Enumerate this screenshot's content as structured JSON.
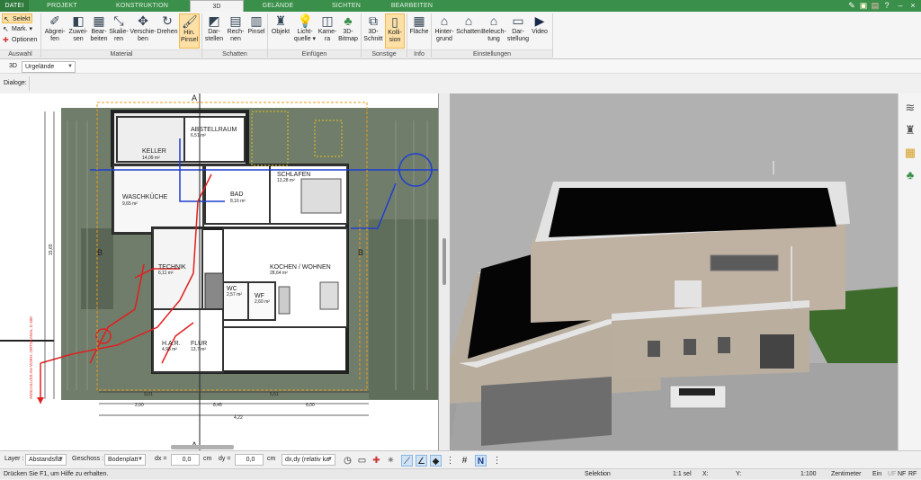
{
  "tabs": [
    {
      "label": "DATEI",
      "kind": "file"
    },
    {
      "label": "PROJEKT",
      "kind": "normal"
    },
    {
      "label": "KONSTRUKTION",
      "kind": "normal"
    },
    {
      "label": "3D",
      "kind": "active"
    },
    {
      "label": "GELÄNDE",
      "kind": "normal"
    },
    {
      "label": "SICHTEN",
      "kind": "normal"
    },
    {
      "label": "BEARBEITEN",
      "kind": "normal"
    }
  ],
  "ribbon": {
    "auswahl": {
      "select": "Selekt",
      "mark": "Mark.",
      "options": "Optionen",
      "group": "Auswahl"
    },
    "material": {
      "group": "Material",
      "buttons": [
        "Abgrei-\nfen",
        "Zuwei-\nsen",
        "Bear-\nbeiten",
        "Skalie-\nren",
        "Verschie-\nben",
        "Drehen",
        "Hin.\nPinsel"
      ]
    },
    "schatten": {
      "group": "Schatten",
      "buttons": [
        "Dar-\nstellen",
        "Rech-\nnen",
        "Pinsel"
      ]
    },
    "einfuegen": {
      "group": "Einfügen",
      "buttons": [
        "Objekt",
        "Licht-\nquelle ▾",
        "Kame-\nra",
        "3D-\nBitmap"
      ]
    },
    "sonstige": {
      "group": "Sonstige",
      "buttons": [
        "3D-\nSchnitt",
        "Kolli-\nsion"
      ]
    },
    "info": {
      "group": "Info",
      "buttons": [
        "Fläche"
      ]
    },
    "einstellungen": {
      "group": "Einstellungen",
      "buttons": [
        "Hinter-\ngrund",
        "Schatten",
        "Beleuch-\ntung",
        "Dar-\nstellung",
        "Video"
      ]
    }
  },
  "optbar": {
    "mode": "3D",
    "terrain": "Urgelände"
  },
  "dialoge": "Dialoge:",
  "plan": {
    "rooms": [
      {
        "name": "KELLER",
        "area": "14,09 m²"
      },
      {
        "name": "ABSTELLRAUM",
        "area": "6,51 m²"
      },
      {
        "name": "WASCHKÜCHE",
        "area": "9,65 m²"
      },
      {
        "name": "BAD",
        "area": "8,16 m²"
      },
      {
        "name": "SCHLAFEN",
        "area": "13,28 m²"
      },
      {
        "name": "TECHNIK",
        "area": "6,11 m²"
      },
      {
        "name": "KOCHEN / WOHNEN",
        "area": "28,64 m²"
      },
      {
        "name": "WC",
        "area": "2,57 m²"
      },
      {
        "name": "WF",
        "area": "2,60 m²"
      },
      {
        "name": "H.A.R.",
        "area": "4,98 m²"
      },
      {
        "name": "FLUR",
        "area": "13,7 m²"
      }
    ],
    "section_marks": [
      "A",
      "A",
      "B",
      "B"
    ],
    "side_note": "ANSCHLUSS AN VORH. ORTSKANAL D 400",
    "dims": [
      "15,65",
      "8,45",
      "6,00",
      "2,00",
      "9,01",
      "5,51",
      "4,22"
    ]
  },
  "bottombar": {
    "layer_label": "Layer :",
    "layer_value": "Abstandsflä",
    "geschoss_label": "Geschoss :",
    "geschoss_value": "Bodenplatt",
    "dx_label": "dx =",
    "dx_value": "0,0",
    "dy_label": "dy =",
    "dy_value": "0,0",
    "unit": "cm",
    "unit2": "cm",
    "mode_value": "dx,dy (relativ ka"
  },
  "status": {
    "hint": "Drücken Sie F1, um Hilfe zu erhalten.",
    "selection": "Selektion",
    "sel_count": "1:1 sel",
    "x": "X:",
    "y": "Y:",
    "scale": "1:100",
    "unit": "Zentimeter",
    "ein": "Ein",
    "uf": "UF",
    "nf": "NF",
    "rf": "RF"
  },
  "colors": {
    "tabbar": "#3a8f4a",
    "roof": "#050505",
    "facade": "#bfb2a3",
    "grass": "#3d6b2c"
  }
}
